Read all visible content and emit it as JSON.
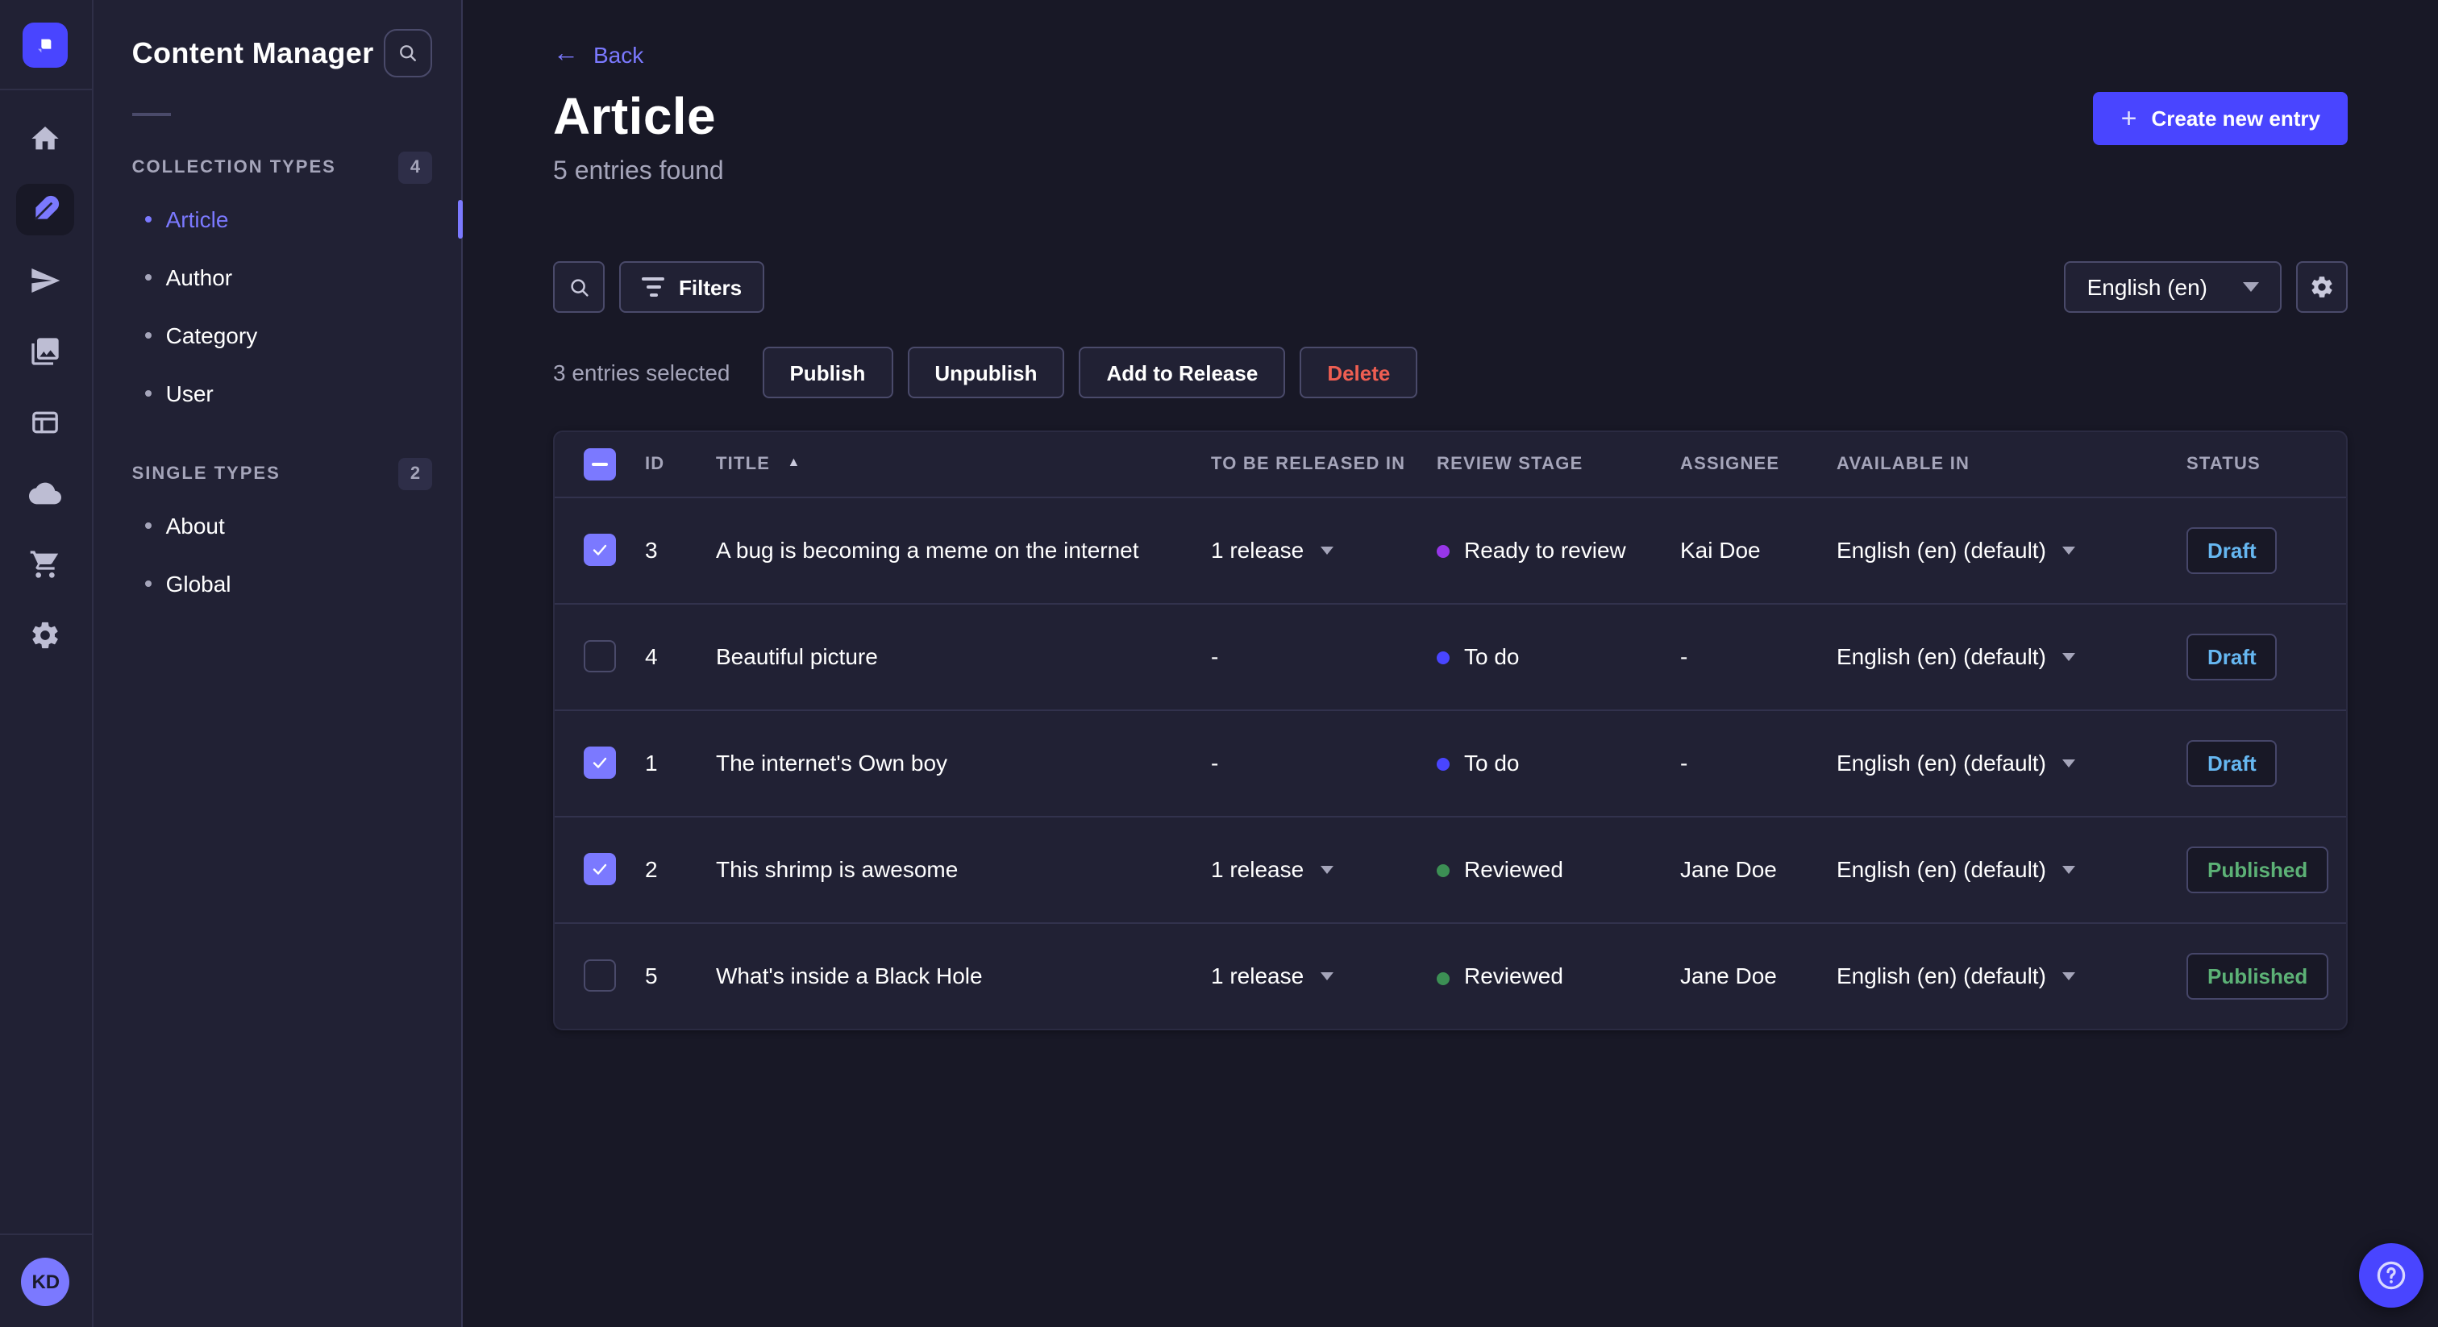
{
  "colors": {
    "primary": "#4945ff",
    "secondary": "#7b79ff",
    "draft_text": "#66b7f1",
    "published_text": "#5cb176",
    "danger_text": "#ee5e52",
    "stage_todo_dot": "#4945ff",
    "stage_ready_dot": "#9736e8",
    "stage_reviewed_dot": "#3c8f54"
  },
  "icons": {
    "rail": [
      "strapi-logo-icon",
      "home-icon",
      "content-manager-feather-icon",
      "releases-paper-plane-icon",
      "media-library-images-icon",
      "content-type-builder-layout-icon",
      "deploy-cloud-icon",
      "marketplace-cart-icon",
      "settings-gear-icon"
    ],
    "other": [
      "search-icon",
      "filter-icon",
      "chevron-down-icon",
      "gear-icon",
      "plus-icon",
      "back-arrow-icon",
      "sort-asc-icon",
      "help-question-icon",
      "checkbox-check-icon",
      "checkbox-indeterminate-icon"
    ]
  },
  "rail": {
    "avatar_initials": "KD"
  },
  "subnav": {
    "title": "Content Manager",
    "sections": [
      {
        "label": "COLLECTION TYPES",
        "badge": "4",
        "items": [
          {
            "label": "Article",
            "active": true
          },
          {
            "label": "Author"
          },
          {
            "label": "Category"
          },
          {
            "label": "User"
          }
        ]
      },
      {
        "label": "SINGLE TYPES",
        "badge": "2",
        "items": [
          {
            "label": "About"
          },
          {
            "label": "Global"
          }
        ]
      }
    ]
  },
  "header": {
    "back_label": "Back",
    "title": "Article",
    "subtitle": "5 entries found",
    "create_label": "Create new entry"
  },
  "toolbar": {
    "filters_label": "Filters",
    "locale_value": "English (en)"
  },
  "selection": {
    "summary": "3 entries selected",
    "publish_label": "Publish",
    "unpublish_label": "Unpublish",
    "add_to_release_label": "Add to Release",
    "delete_label": "Delete"
  },
  "table": {
    "columns": {
      "id": "ID",
      "title": "TITLE",
      "released": "TO BE RELEASED IN",
      "stage": "REVIEW STAGE",
      "assignee": "ASSIGNEE",
      "available": "AVAILABLE IN",
      "status": "STATUS"
    },
    "rows": [
      {
        "checked": true,
        "id": "3",
        "title": "A bug is becoming a meme on the internet",
        "released": "1 release",
        "stage": "Ready to review",
        "stage_color": "#9736e8",
        "assignee": "Kai Doe",
        "available": "English (en) (default)",
        "status": "Draft",
        "status_color": "#66b7f1"
      },
      {
        "checked": false,
        "id": "4",
        "title": "Beautiful picture",
        "released": "-",
        "stage": "To do",
        "stage_color": "#4945ff",
        "assignee": "-",
        "available": "English (en) (default)",
        "status": "Draft",
        "status_color": "#66b7f1"
      },
      {
        "checked": true,
        "id": "1",
        "title": "The internet's Own boy",
        "released": "-",
        "stage": "To do",
        "stage_color": "#4945ff",
        "assignee": "-",
        "available": "English (en) (default)",
        "status": "Draft",
        "status_color": "#66b7f1"
      },
      {
        "checked": true,
        "id": "2",
        "title": "This shrimp is awesome",
        "released": "1 release",
        "stage": "Reviewed",
        "stage_color": "#3c8f54",
        "assignee": "Jane Doe",
        "available": "English (en) (default)",
        "status": "Published",
        "status_color": "#5cb176"
      },
      {
        "checked": false,
        "id": "5",
        "title": "What's inside a Black Hole",
        "released": "1 release",
        "stage": "Reviewed",
        "stage_color": "#3c8f54",
        "assignee": "Jane Doe",
        "available": "English (en) (default)",
        "status": "Published",
        "status_color": "#5cb176"
      }
    ]
  }
}
